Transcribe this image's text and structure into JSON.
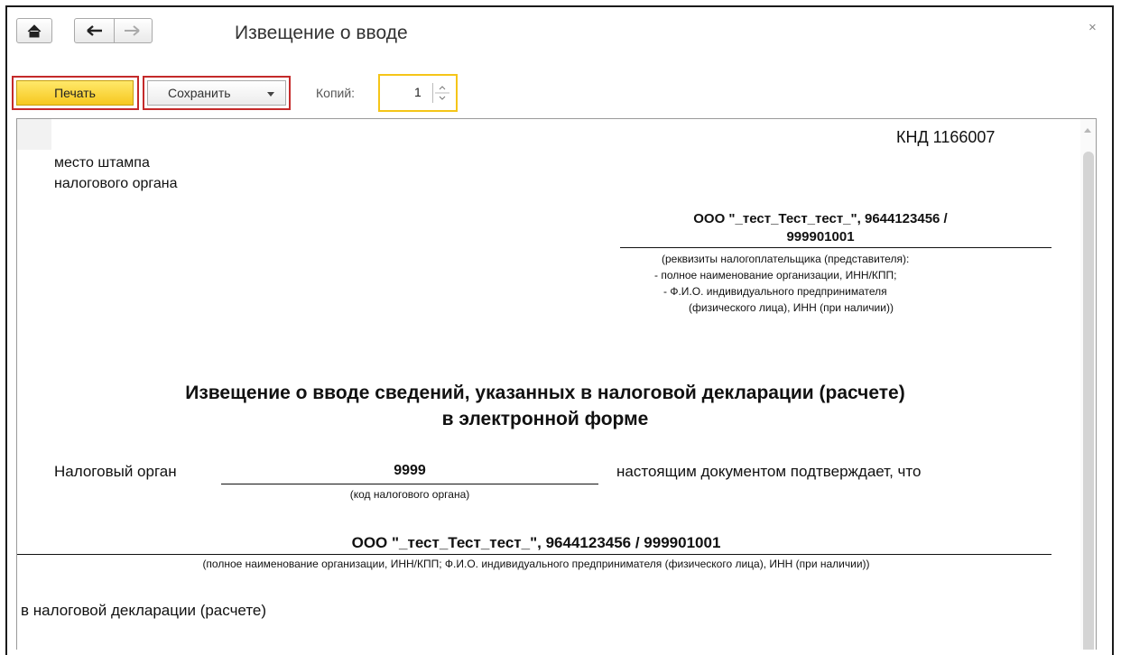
{
  "window": {
    "title": "Извещение о вводе",
    "close_glyph": "×"
  },
  "toolbar": {
    "print_label": "Печать",
    "save_label": "Сохранить",
    "copies_label": "Копий:",
    "copies_value": "1"
  },
  "icons": {
    "home": "home-icon",
    "back": "arrow-left-icon",
    "forward": "arrow-right-icon"
  },
  "document": {
    "knd": "КНД 1166007",
    "stamp_line1": "место штампа",
    "stamp_line2": "налогового органа",
    "taxpayer_line1": "ООО \"_тест_Тест_тест_\", 9644123456 /",
    "taxpayer_line2": "999901001",
    "req_line1": "(реквизиты налогоплательщика (представителя):",
    "req_line2": "- полное наименование организации, ИНН/КПП;",
    "req_line3": "- Ф.И.О. индивидуального предпринимателя",
    "req_line4": "(физического лица), ИНН (при наличии))",
    "heading_line1": "Извещение о вводе сведений, указанных в налоговой декларации (расчете)",
    "heading_line2": "в электронной форме",
    "tax_authority_label": "Налоговый орган",
    "tax_authority_code": "9999",
    "tax_authority_code_caption": "(код налогового органа)",
    "confirms_text": "настоящим документом подтверждает, что",
    "org_full": "ООО \"_тест_Тест_тест_\", 9644123456 / 999901001",
    "org_caption": "(полное наименование организации, ИНН/КПП; Ф.И.О. индивидуального предпринимателя (физического лица), ИНН (при наличии))",
    "in_declaration": "в налоговой декларации (расчете)"
  },
  "colors": {
    "accent_yellow": "#f6c81f",
    "highlight_red": "#c42a2a"
  }
}
